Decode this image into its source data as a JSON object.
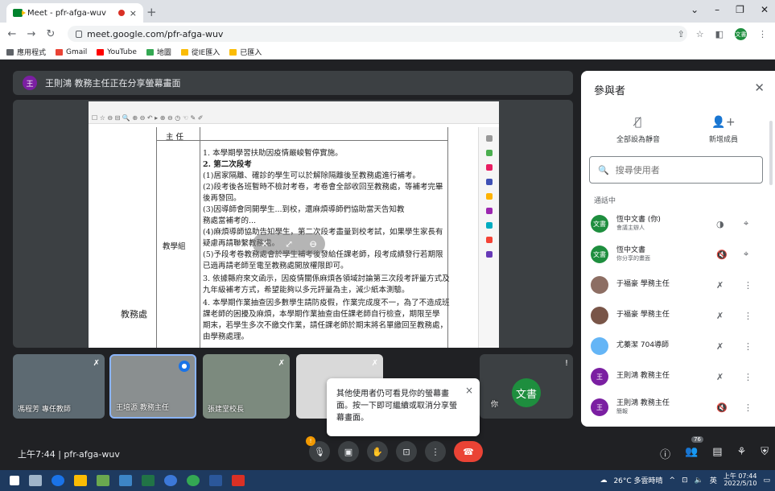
{
  "browser": {
    "tab_title": "Meet - pfr-afga-wuv",
    "tab_close": "×",
    "new_tab": "+",
    "url": "meet.google.com/pfr-afga-wuv",
    "profile_initials": "文書",
    "window_controls": [
      "⌄",
      "–",
      "❐",
      "✕"
    ],
    "bookmarks": [
      {
        "label": "應用程式",
        "color": "#5f6368"
      },
      {
        "label": "Gmail",
        "color": "#ea4335"
      },
      {
        "label": "YouTube",
        "color": "#ff0000"
      },
      {
        "label": "地圖",
        "color": "#34a853"
      },
      {
        "label": "從IE匯入",
        "color": "#fbbc04"
      },
      {
        "label": "已匯入",
        "color": "#fbbc04"
      }
    ]
  },
  "meet": {
    "presenting_banner": "王則鴻 教務主任正在分享螢幕畫面",
    "presenter_initial": "王",
    "time": "上午7:44",
    "meeting_code": "pfr-afga-wuv",
    "toast": "其他使用者仍可看見你的螢幕畫面。按一下即可繼續或取消分享螢幕畫面。",
    "toast_close": "×",
    "participant_count": "76",
    "controls_alert": "!"
  },
  "shared_doc": {
    "header_col": "主 任",
    "row_label_1": "教學組",
    "row_label_2": "教務處",
    "lines": [
      "1. 本學期學習扶助因疫情嚴峻暫停實施。",
      "2. 第二次段考",
      "  (1)居家隔離、確診的學生可以於解除隔離後至教務處進行補考。",
      "  (2)段考後各班暫時不檢討考卷，考卷會全部收回至教務處，等補考完畢",
      "  後再發回。",
      "  (3)因導師會同開學生...到校，還麻煩導師們協助當天告知教",
      "  務處當補考的...",
      "  (4)麻煩導師協助告知學生，第二次段考盡量到校考試，如果學生家長有",
      "  疑慮再請聯繫教務處。",
      "  (5)予段考卷教務處會於學生補考後發給任課老師，段考成績發行若期限",
      "  已過再請老師至電至教務處開放權限即可。",
      "3. 依據縣府來文函示，因疫情關係麻煩各領域討論第三次段考評量方式及",
      "  九年級補考方式，希望能夠以多元評量為主，減少紙本測驗。",
      "4. 本學期作業抽查因多數學生請防疫假，作業完成度不一，為了不造成班",
      "  課老師的困擾及麻煩，本學期作業抽查由任課老師自行檢查，期限至學",
      "  期末，若學生多次不繳交作業，請任課老師於期末將名單繳回至教務處，",
      "  由學務處理。"
    ]
  },
  "tiles": [
    {
      "name": "馮程芳 專任教師"
    },
    {
      "name": "王培源 教務主任"
    },
    {
      "name": "張建堂校長"
    },
    {
      "name": ""
    },
    {
      "name": "你",
      "avatar": "文書"
    }
  ],
  "panel": {
    "title": "參與者",
    "mute_all": "全部設為靜音",
    "add_member": "新增成員",
    "search_placeholder": "搜尋使用者",
    "in_call": "通話中",
    "people": [
      {
        "name": "恆中文書 (你)",
        "sub": "會議主辦人",
        "initials": "文書",
        "color": "#1e8e3e"
      },
      {
        "name": "恆中文書",
        "sub": "你分享的畫面",
        "initials": "文書",
        "color": "#1e8e3e"
      },
      {
        "name": "于福豪 學務主任",
        "sub": "",
        "initials": "",
        "color": "#8d6e63"
      },
      {
        "name": "于福豪 學務主任",
        "sub": "",
        "initials": "",
        "color": "#795548"
      },
      {
        "name": "尤蓁潔 704導師",
        "sub": "",
        "initials": "",
        "color": "#64b5f6"
      },
      {
        "name": "王則鴻 教務主任",
        "sub": "",
        "initials": "王",
        "color": "#7b1fa2"
      },
      {
        "name": "王則鴻 教務主任",
        "sub": "簡報",
        "initials": "王",
        "color": "#7b1fa2"
      }
    ]
  },
  "taskbar": {
    "weather": "26°C 多雲時晴",
    "ime": "英",
    "clock_time": "上午 07:44",
    "clock_date": "2022/5/10"
  }
}
